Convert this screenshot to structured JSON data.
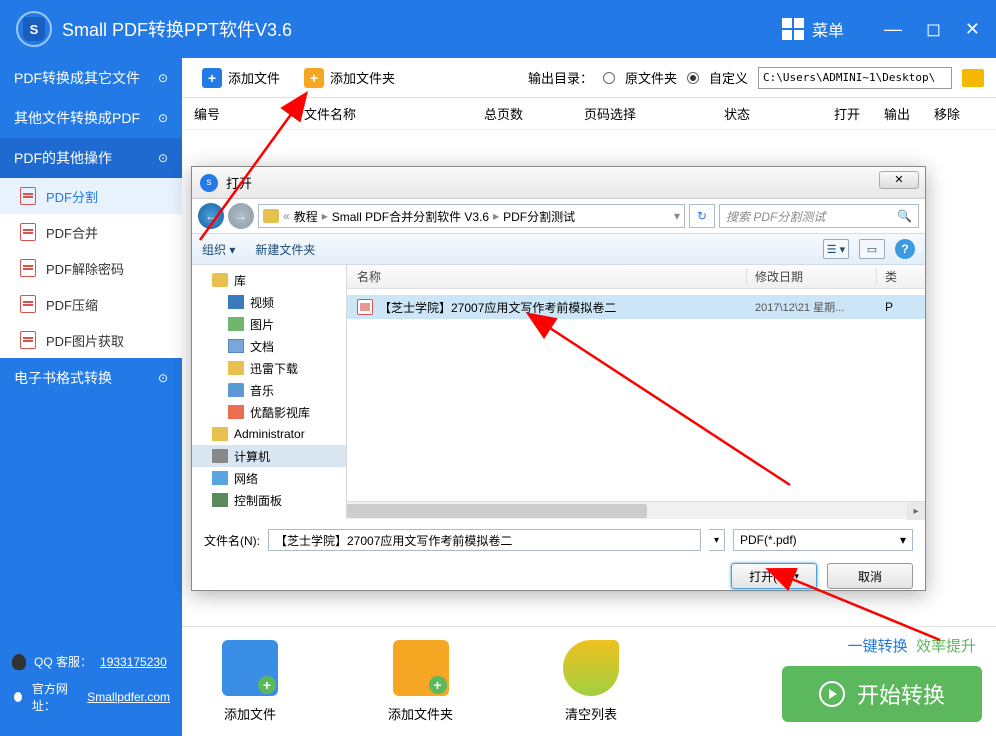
{
  "app": {
    "title": "Small  PDF转换PPT软件V3.6",
    "menu_label": "菜单"
  },
  "sidebar": {
    "cats": [
      {
        "label": "PDF转换成其它文件"
      },
      {
        "label": "其他文件转换成PDF"
      },
      {
        "label": "PDF的其他操作"
      },
      {
        "label": "电子书格式转换"
      }
    ],
    "pdf_ops": [
      {
        "label": "PDF分割"
      },
      {
        "label": "PDF合并"
      },
      {
        "label": "PDF解除密码"
      },
      {
        "label": "PDF压缩"
      },
      {
        "label": "PDF图片获取"
      }
    ],
    "footer": {
      "qq_label": "QQ 客服：",
      "qq_num": "1933175230",
      "site_label": "官方网址：",
      "site_url": "Smallpdfer.com"
    }
  },
  "toolbar": {
    "add_file": "添加文件",
    "add_folder": "添加文件夹",
    "output_label": "输出目录：",
    "opt_orig": "原文件夹",
    "opt_custom": "自定义",
    "path": "C:\\Users\\ADMINI~1\\Desktop\\"
  },
  "table_head": [
    "编号",
    "文件名称",
    "总页数",
    "页码选择",
    "状态",
    "打开",
    "输出",
    "移除"
  ],
  "bottom": {
    "add_file": "添加文件",
    "add_folder": "添加文件夹",
    "clear": "清空列表",
    "slogan1": "一键转换",
    "slogan2": "效率提升",
    "start": "开始转换"
  },
  "dialog": {
    "title": "打开",
    "crumbs": [
      "教程",
      "Small PDF合并分割软件 V3.6",
      "PDF分割测试"
    ],
    "search_ph": "搜索 PDF分割测试",
    "tool_org": "组织 ▾",
    "tool_new": "新建文件夹",
    "tree": {
      "lib": "库",
      "video": "视频",
      "pic": "图片",
      "doc": "文档",
      "dl": "迅雷下载",
      "music": "音乐",
      "youku": "优酷影视库",
      "admin": "Administrator",
      "pc": "计算机",
      "net": "网络",
      "ctrl": "控制面板"
    },
    "list_head": {
      "name": "名称",
      "date": "修改日期",
      "type": "类"
    },
    "file": {
      "name": "【芝士学院】27007应用文写作考前模拟卷二",
      "date": "2017\\12\\21 星期...",
      "type": "P"
    },
    "fn_label": "文件名(N):",
    "fn_value": "【芝士学院】27007应用文写作考前模拟卷二",
    "type_filter": "PDF(*.pdf)",
    "btn_open": "打开(O)",
    "btn_cancel": "取消"
  }
}
